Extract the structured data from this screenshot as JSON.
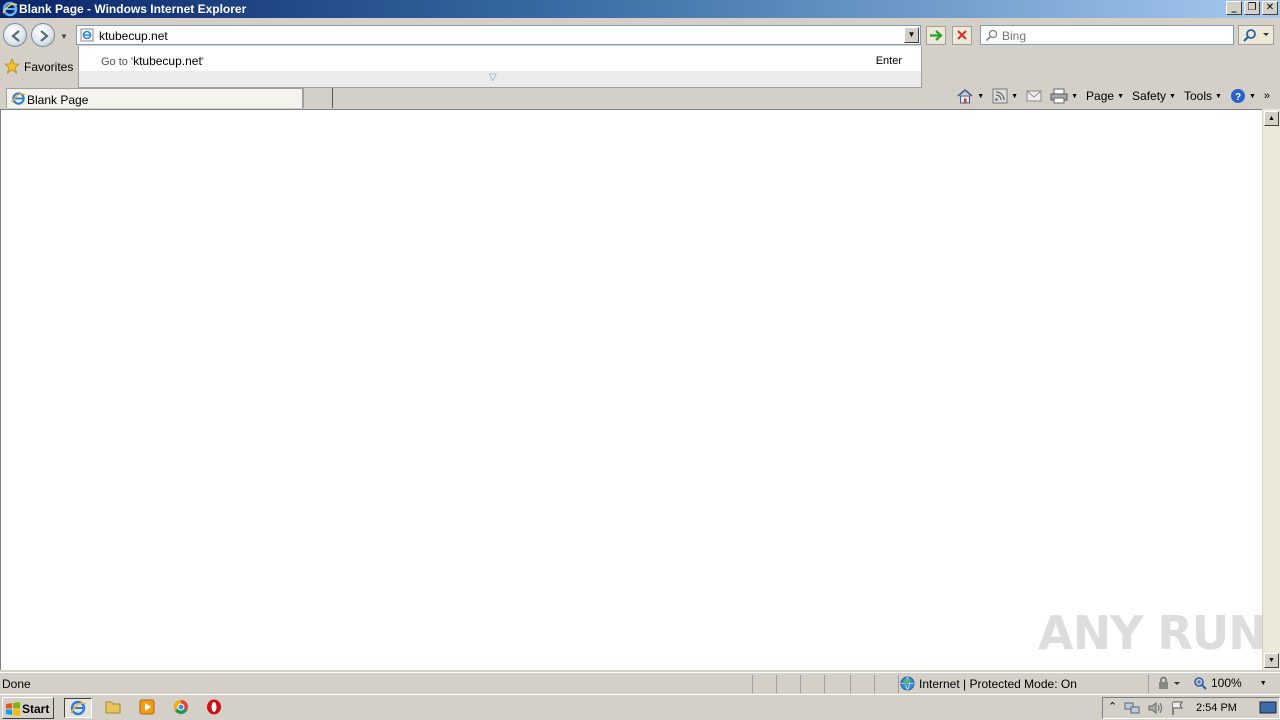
{
  "window": {
    "title": "Blank Page - Windows Internet Explorer"
  },
  "navbar": {
    "address": "ktubecup.net",
    "search_placeholder": "Bing"
  },
  "autocomplete": {
    "go_to_prefix": "Go to '",
    "go_to_target": "ktubecup.net",
    "go_to_suffix": "'",
    "enter_hint": "Enter"
  },
  "favorites": {
    "label": "Favorites"
  },
  "tabs": [
    {
      "label": "Blank Page"
    }
  ],
  "toolbar": {
    "page": "Page",
    "safety": "Safety",
    "tools": "Tools"
  },
  "status": {
    "text": "Done",
    "zone": "Internet | Protected Mode: On",
    "zoom": "100%"
  },
  "watermark": "ANY RUN",
  "taskbar": {
    "start": "Start",
    "clock": "2:54 PM"
  }
}
